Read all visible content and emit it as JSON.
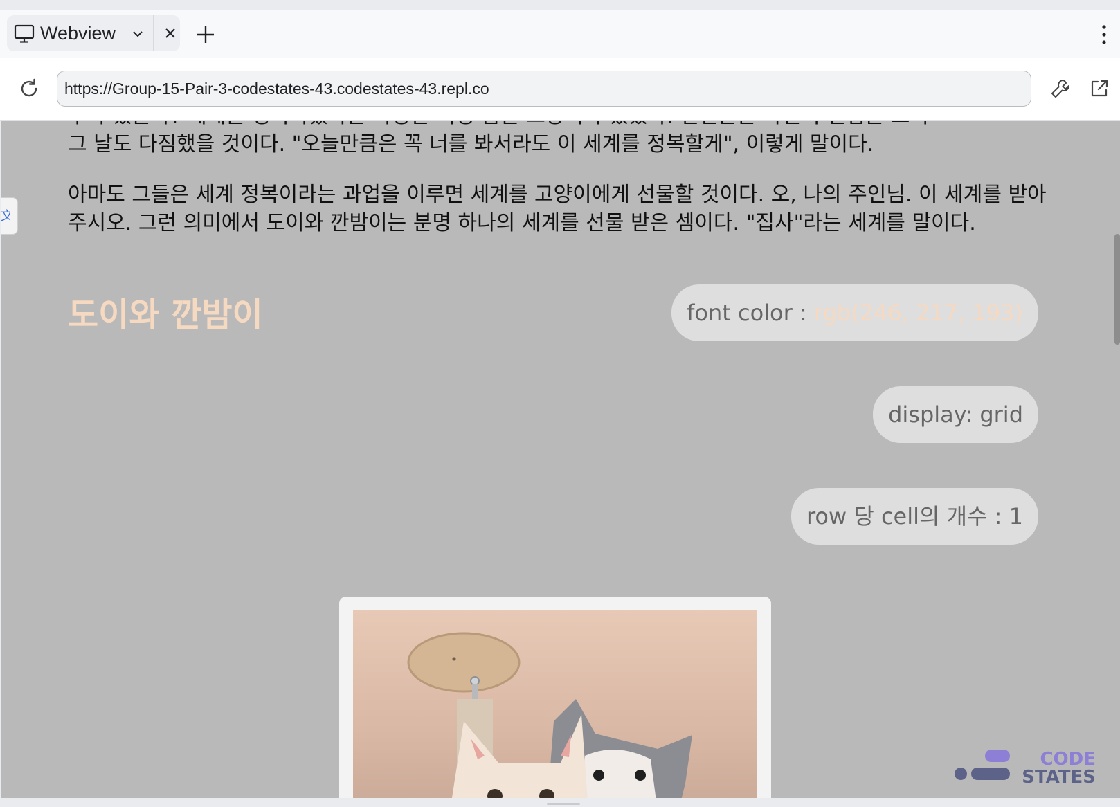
{
  "browser": {
    "tab_title": "Webview",
    "url": "https://Group-15-Pair-3-codestates-43.codestates-43.repl.co"
  },
  "content": {
    "paragraph_partial_line1": "누가 있을까? 세계를 정복하겠다는 야망은 식빵 굽는 고양이가 있었다. 일전불은 자신의 신념을 보이",
    "paragraph_partial_line2": "그 날도 다짐했을 것이다. \"오늘만큼은 꼭 너를 봐서라도 이 세계를 정복할게\", 이렇게 말이다.",
    "paragraph2": "아마도 그들은 세계 정복이라는 과업을 이루면 세계를 고양이에게 선물할 것이다. 오, 나의 주인님. 이 세계를 받아주시오. 그런 의미에서 도이와 깐밤이는 분명 하나의 세계를 선물 받은 셈이다. \"집사\"라는 세계를 말이다.",
    "heading": "도이와 깐밤이",
    "pill_font_color_label": "font color : ",
    "pill_font_color_value": "rgb(246, 217, 193)",
    "pill_display": "display: grid",
    "pill_cells": "row 당 cell의 개수 : 1",
    "logo_line1": "CODE",
    "logo_line2": "STATES"
  },
  "colors": {
    "page_bg": "#b9b9b9",
    "heading_color": "#f6d9c1",
    "logo_purple": "#8d7fd6",
    "logo_slate": "#5d6288"
  },
  "icons": [
    "monitor-icon",
    "chevron-down-icon",
    "close-icon",
    "plus-icon",
    "more-vert-icon",
    "reload-icon",
    "wrench-icon",
    "open-external-icon",
    "translate-icon",
    "codestates-logo"
  ]
}
